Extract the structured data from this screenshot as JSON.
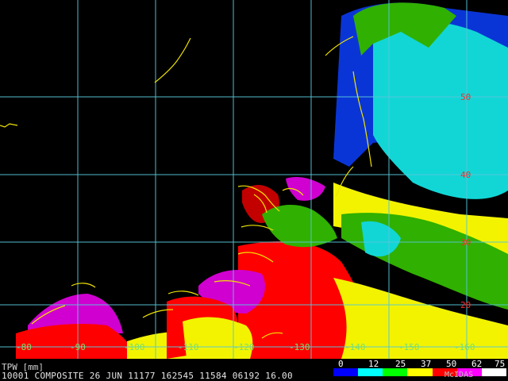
{
  "map": {
    "lat_labels": [
      "50",
      "40",
      "30",
      "20"
    ],
    "lon_labels": [
      "-80",
      "-90",
      "-100",
      "-110",
      "-120",
      "-130",
      "-140",
      "-150",
      "-160"
    ],
    "colors": {
      "background": "#000000",
      "grid": "#57c7d9",
      "coast": "#f0e400",
      "land_palette": [
        "#7a0000",
        "#c30000",
        "#ff0000",
        "#ff8a00",
        "#f3f300",
        "#b7dd00",
        "#30b000",
        "#00c850",
        "#0a35d6",
        "#12d6d6",
        "#7be8e8",
        "#d000d0",
        "#ff4dff"
      ]
    }
  },
  "footer": {
    "title": "TPW [mm]",
    "line": "10001 COMPOSITE  26 JUN 11177 162545 11584 06192 16.00",
    "legend_ticks": [
      "0",
      "12",
      "25",
      "37",
      "50",
      "62",
      "75"
    ],
    "legend_colors": [
      "#0000ff",
      "#00ffff",
      "#00ff00",
      "#ffff00",
      "#ff0000",
      "#ff00ff",
      "#ffffff"
    ],
    "mcidas": "McIDAS"
  }
}
